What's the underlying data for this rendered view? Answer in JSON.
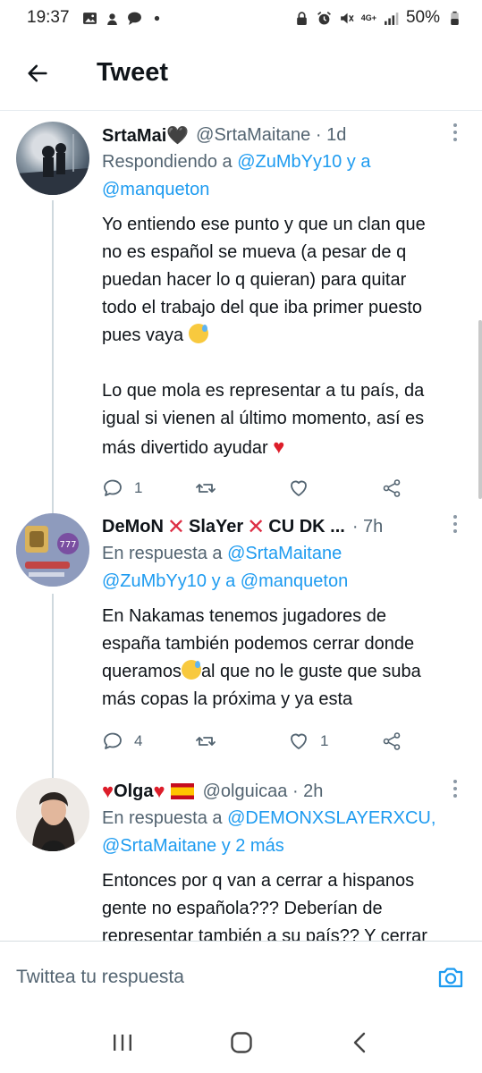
{
  "status_bar": {
    "time": "19:37",
    "network": "4G+",
    "battery": "50%"
  },
  "header": {
    "title": "Tweet",
    "back_icon": "arrow-left-icon"
  },
  "tweets": [
    {
      "name": "SrtaMai🖤",
      "handle": "@SrtaMaitane · 1d",
      "reply_prefix": "Respondiendo a ",
      "reply_users": "@ZuMbYy10 y a",
      "reply_users_line2": "@manqueton",
      "text_lines": [
        "Yo entiendo ese punto y que un clan que",
        "no es español se mueva (a pesar de q",
        "puedan hacer lo q quieran) para quitar",
        "todo el trabajo del que iba primer puesto",
        "pues vaya"
      ],
      "text_lines_2": [
        "Lo que mola es representar a tu país, da",
        "igual si vienen al último momento, así es",
        "más divertido ayudar"
      ],
      "replies": "1",
      "likes": ""
    },
    {
      "name_parts": [
        "DeMoN",
        "SlaYer",
        "CU DK ..."
      ],
      "handle": "· 7h",
      "reply_prefix": "En respuesta a ",
      "reply_users": "@SrtaMaitane",
      "reply_users_line2": "@ZuMbYy10 y a @manqueton",
      "text_lines": [
        "En Nakamas tenemos jugadores de",
        "españa también podemos cerrar donde",
        "queramos",
        "al que no le guste que suba",
        "más copas la próxima y ya esta"
      ],
      "replies": "4",
      "likes": "1"
    },
    {
      "name": "Olga",
      "handle": "@olguicaa · 2h",
      "reply_prefix": "En respuesta a ",
      "reply_users": "@DEMONXSLAYERXCU,",
      "reply_users_line2": "@SrtaMaitane y 2 más",
      "text_lines": [
        "Entonces por q van a cerrar a hispanos",
        "gente no española??? Deberían de",
        "representar también a su país?? Y cerrar"
      ]
    }
  ],
  "composer": {
    "placeholder": "Twittea tu respuesta",
    "camera_icon": "camera-icon"
  },
  "colors": {
    "link": "#1d9bf0",
    "secondary_text": "#536471",
    "heart": "#dd1d2a"
  }
}
